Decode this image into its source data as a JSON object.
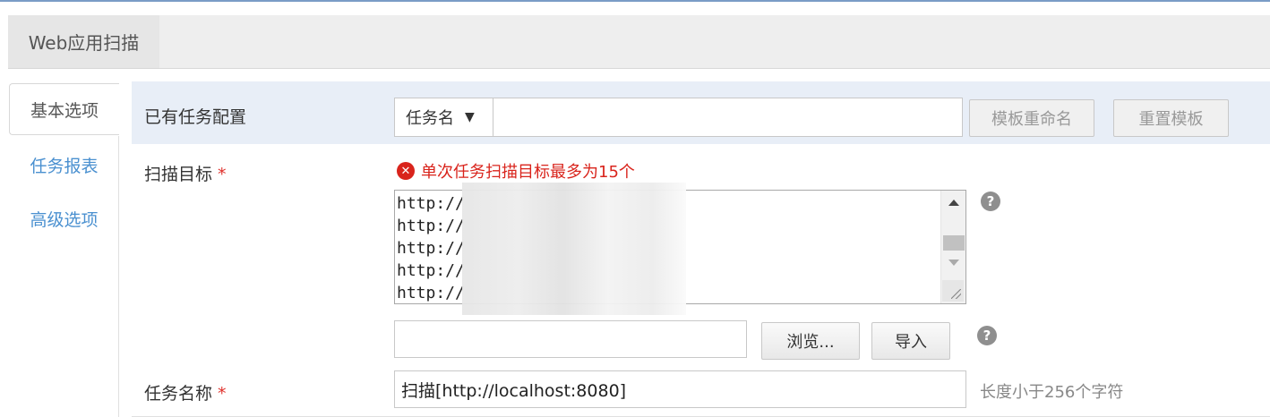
{
  "header": {
    "tab_label": "Web应用扫描"
  },
  "sidebar": {
    "tabs": [
      {
        "label": "基本选项",
        "active": true
      },
      {
        "label": "任务报表",
        "active": false
      },
      {
        "label": "高级选项",
        "active": false
      }
    ]
  },
  "template": {
    "label": "已有任务配置",
    "select_value": "任务名",
    "input_value": "",
    "rename_button": "模板重命名",
    "reset_button": "重置模板"
  },
  "targets": {
    "label": "扫描目标",
    "required_mark": "*",
    "error": "单次任务扫描目标最多为15个",
    "lines": [
      "http://",
      "http://",
      "http://",
      "http://",
      "http://"
    ],
    "help": "?"
  },
  "file_import": {
    "value": "",
    "browse_button": "浏览...",
    "import_button": "导入",
    "help": "?"
  },
  "task_name": {
    "label": "任务名称",
    "required_mark": "*",
    "value": "扫描[http://localhost:8080]",
    "hint": "长度小于256个字符"
  },
  "colors": {
    "accent_link": "#4a90d0",
    "error": "#d9241c",
    "row_highlight": "#e8eef7"
  }
}
